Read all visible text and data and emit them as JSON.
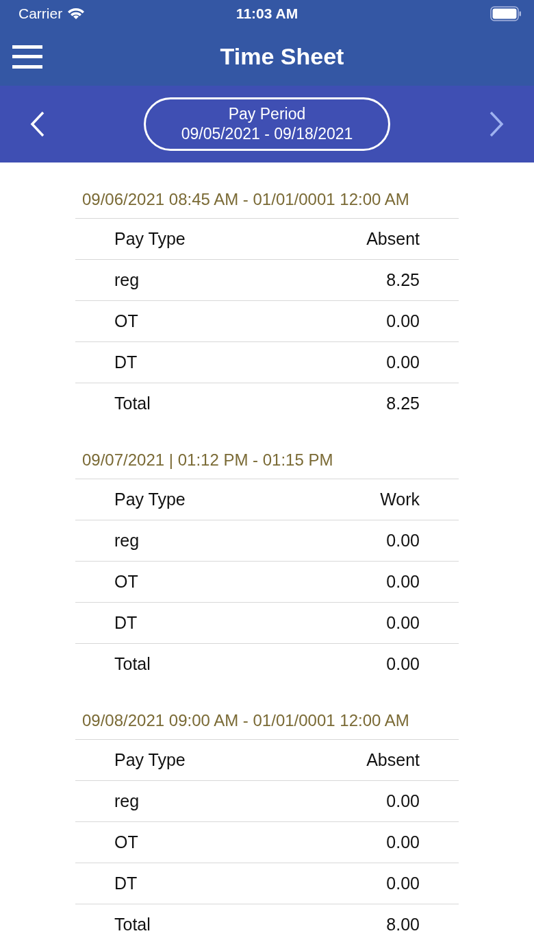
{
  "status_bar": {
    "carrier": "Carrier",
    "time": "11:03 AM"
  },
  "nav": {
    "title": "Time Sheet"
  },
  "period": {
    "label": "Pay Period",
    "range": "09/05/2021 - 09/18/2021",
    "prev_disabled": false,
    "next_disabled": true
  },
  "entries": [
    {
      "heading": "09/06/2021 08:45 AM - 01/01/0001 12:00 AM",
      "columns": [
        "Pay Type",
        "Absent"
      ],
      "rows": [
        [
          "reg",
          "8.25"
        ],
        [
          "OT",
          "0.00"
        ],
        [
          "DT",
          "0.00"
        ],
        [
          "Total",
          "8.25"
        ]
      ]
    },
    {
      "heading": "09/07/2021 | 01:12 PM - 01:15 PM",
      "columns": [
        "Pay Type",
        "Work"
      ],
      "rows": [
        [
          "reg",
          "0.00"
        ],
        [
          "OT",
          "0.00"
        ],
        [
          "DT",
          "0.00"
        ],
        [
          "Total",
          "0.00"
        ]
      ]
    },
    {
      "heading": "09/08/2021 09:00 AM - 01/01/0001 12:00 AM",
      "columns": [
        "Pay Type",
        "Absent"
      ],
      "rows": [
        [
          "reg",
          "0.00"
        ],
        [
          "OT",
          "0.00"
        ],
        [
          "DT",
          "0.00"
        ],
        [
          "Total",
          "8.00"
        ]
      ]
    }
  ]
}
